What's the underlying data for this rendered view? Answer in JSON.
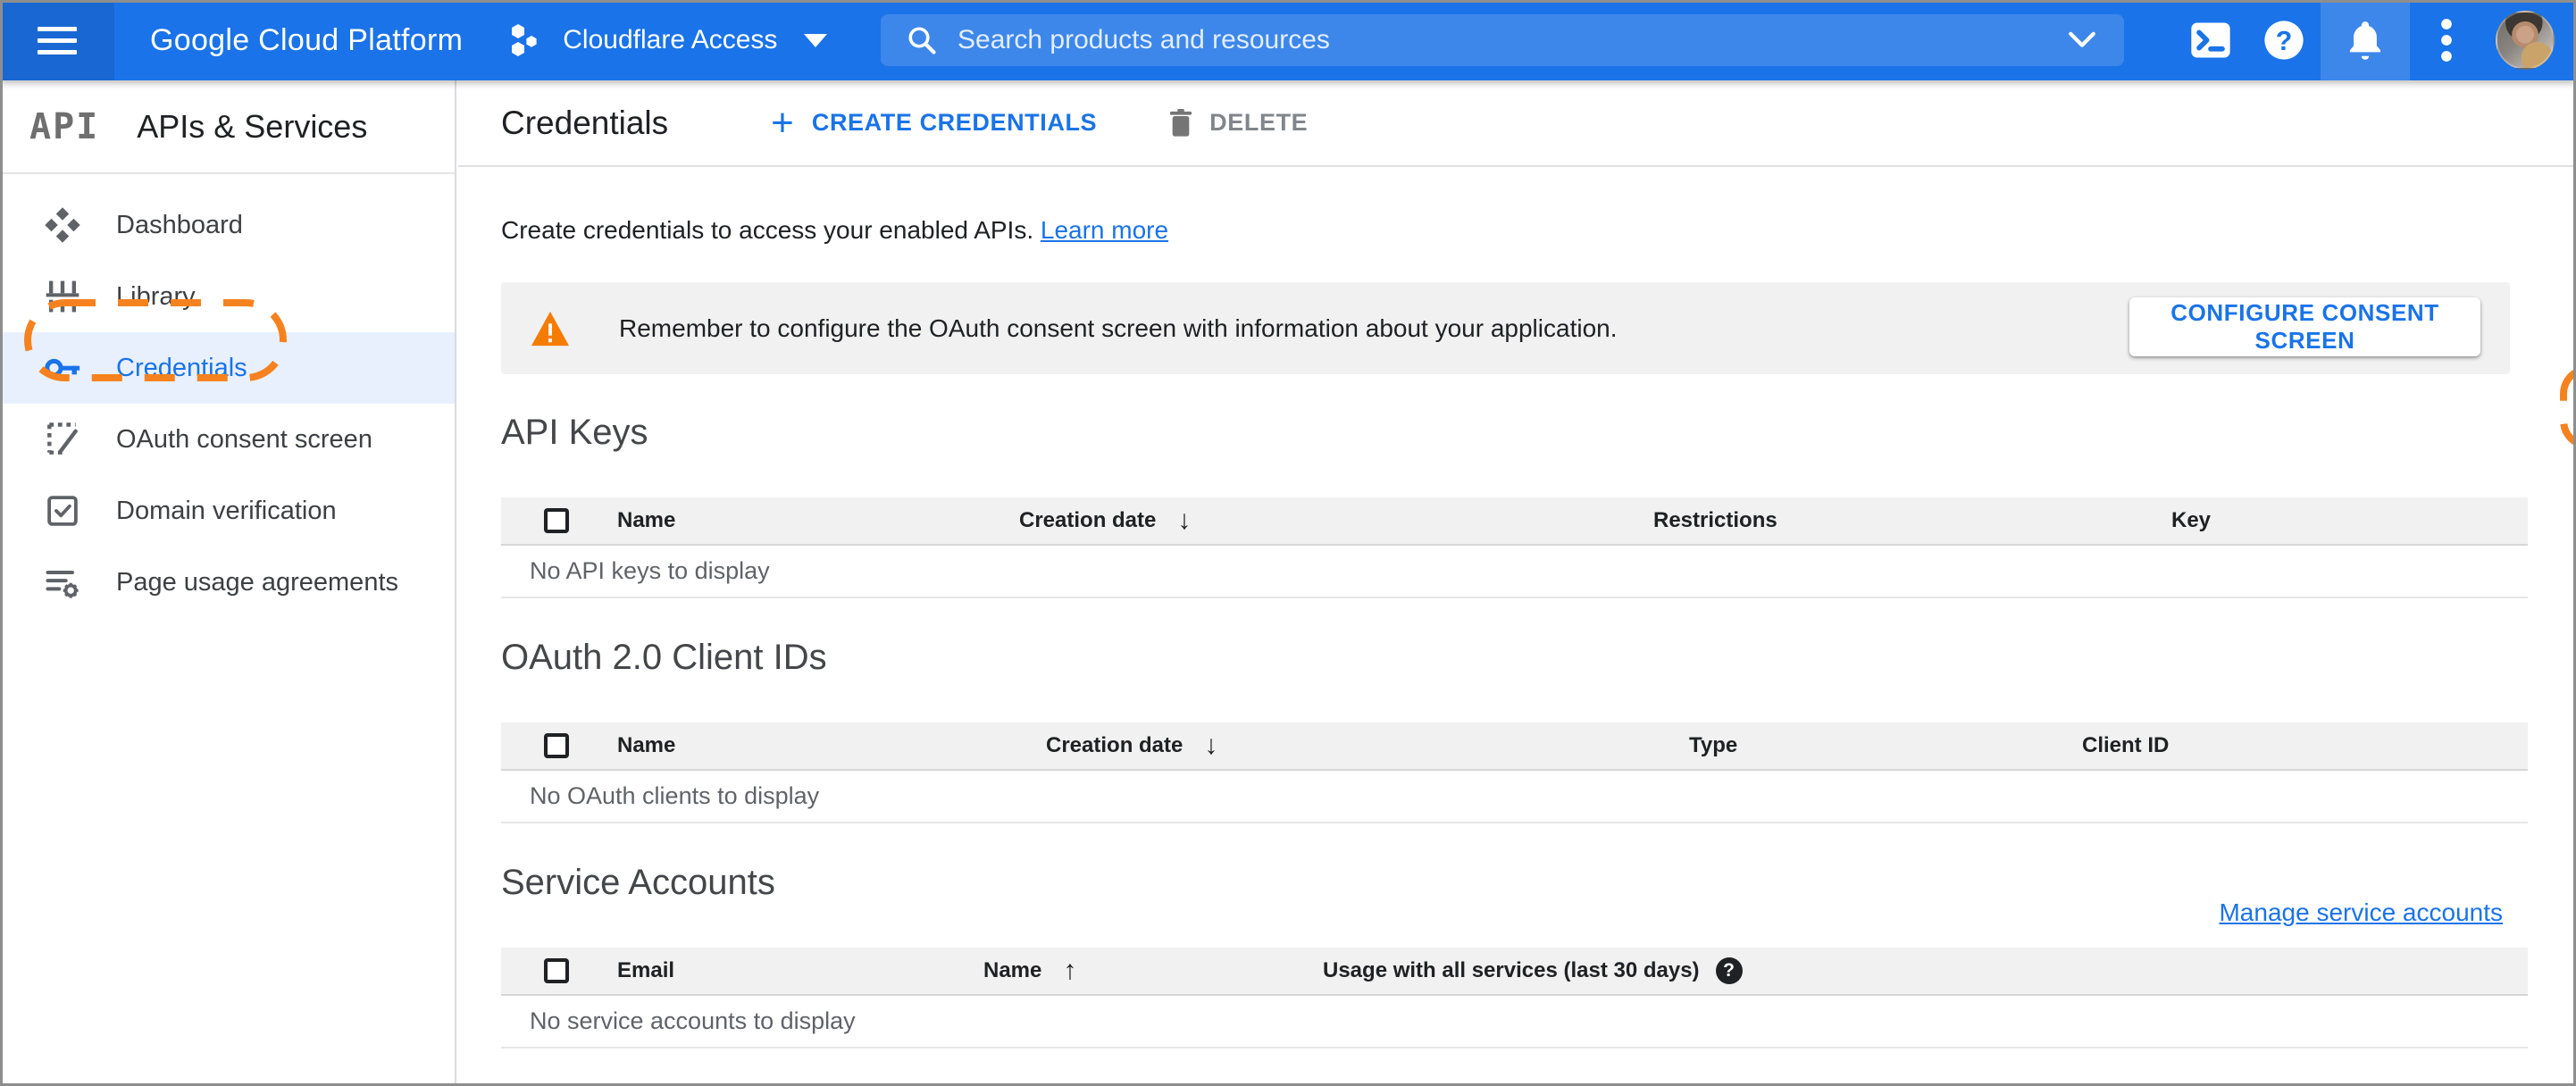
{
  "header": {
    "logo": "Google Cloud Platform",
    "project_name": "Cloudflare Access",
    "search_placeholder": "Search products and resources"
  },
  "sidebar": {
    "logo": "API",
    "title": "APIs & Services",
    "items": [
      {
        "label": "Dashboard"
      },
      {
        "label": "Library"
      },
      {
        "label": "Credentials"
      },
      {
        "label": "OAuth consent screen"
      },
      {
        "label": "Domain verification"
      },
      {
        "label": "Page usage agreements"
      }
    ]
  },
  "toolbar": {
    "title": "Credentials",
    "plus": "+",
    "create_label": "CREATE CREDENTIALS",
    "delete_label": "DELETE"
  },
  "intro": {
    "text": "Create credentials to access your enabled APIs.",
    "link": "Learn more"
  },
  "banner": {
    "text": "Remember to configure the OAuth consent screen with information about your application.",
    "button_label": "CONFIGURE CONSENT SCREEN"
  },
  "sections": {
    "api_keys": {
      "title": "API Keys",
      "columns": {
        "name": "Name",
        "creation": "Creation date",
        "restrictions": "Restrictions",
        "key": "Key"
      },
      "sort_arrow": "↓",
      "empty": "No API keys to display"
    },
    "oauth": {
      "title": "OAuth 2.0 Client IDs",
      "columns": {
        "name": "Name",
        "creation": "Creation date",
        "type": "Type",
        "client_id": "Client ID"
      },
      "sort_arrow": "↓",
      "empty": "No OAuth clients to display"
    },
    "service_accounts": {
      "title": "Service Accounts",
      "manage_link": "Manage service accounts",
      "columns": {
        "email": "Email",
        "name": "Name",
        "usage": "Usage with all services (last 30 days)"
      },
      "sort_arrow": "↑",
      "help_glyph": "?",
      "empty": "No service accounts to display"
    }
  },
  "colors": {
    "header_blue": "#1a73e8",
    "header_dark_blue": "#1967d2",
    "search_pill_blue": "#3d87ea",
    "selected_item_bg": "#e8f0fe",
    "accent_blue": "#1a73e8",
    "annotation_orange": "#f5821f",
    "warning_orange": "#f57c00",
    "banner_gray": "#f1f1f1",
    "table_header_gray": "#f1f1f1"
  }
}
